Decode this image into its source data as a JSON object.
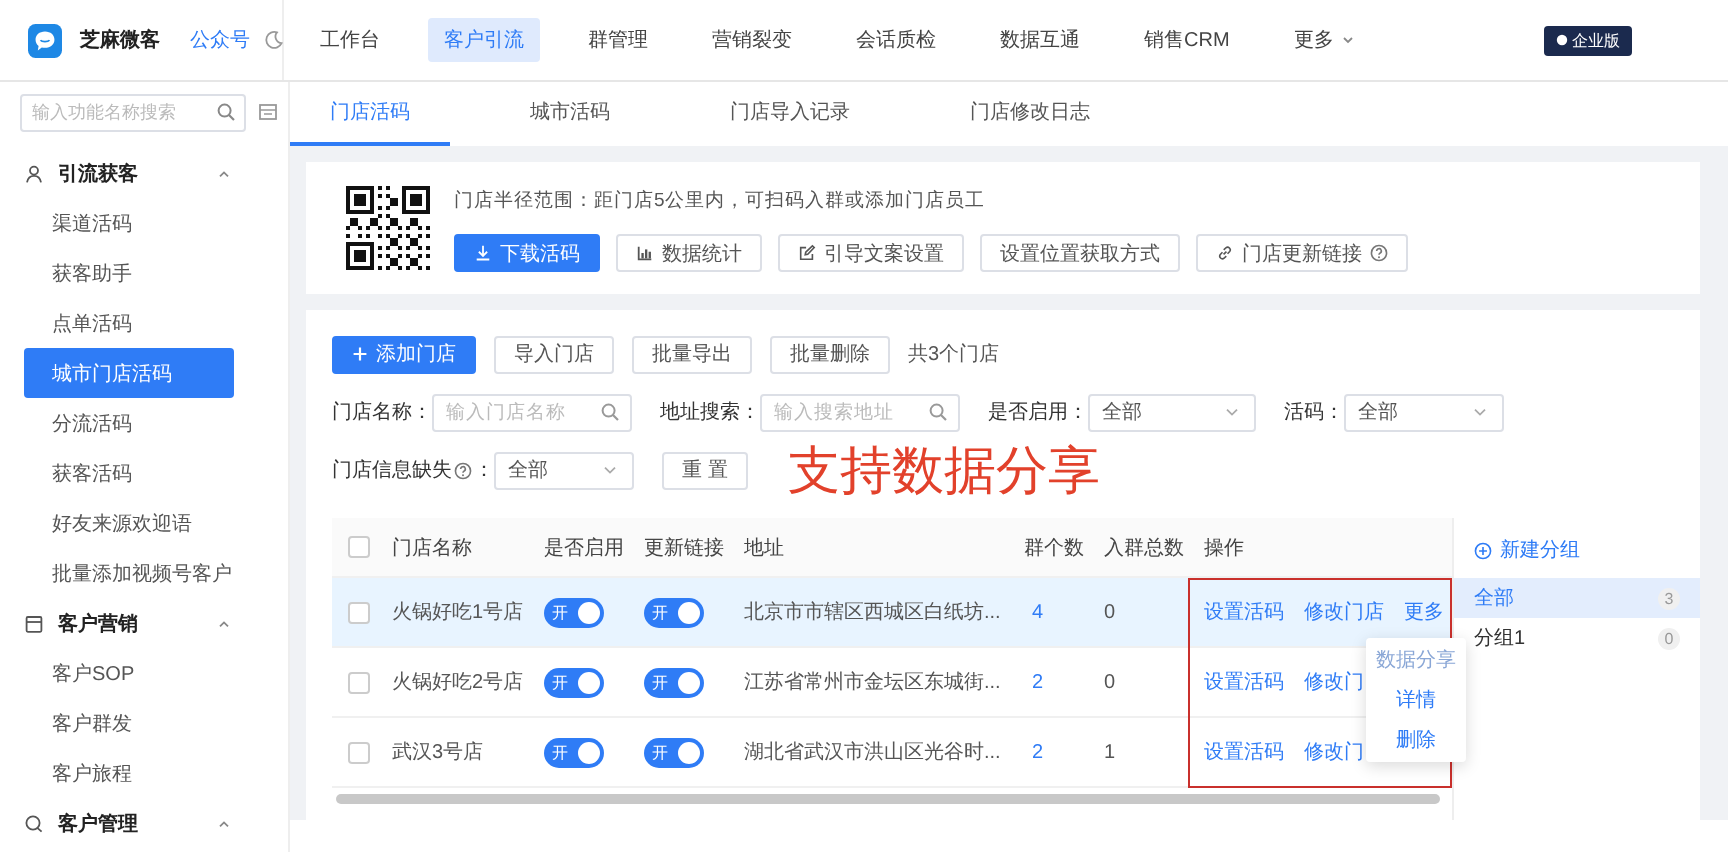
{
  "app": {
    "name": "芝麻微客",
    "account_link": "公众号"
  },
  "nav": [
    {
      "label": "工作台",
      "selected": false,
      "kind": "link"
    },
    {
      "label": "客户引流",
      "selected": true,
      "kind": "link"
    },
    {
      "label": "群管理",
      "selected": false,
      "kind": "link"
    },
    {
      "label": "营销裂变",
      "selected": false,
      "kind": "link"
    },
    {
      "label": "会话质检",
      "selected": false,
      "kind": "link"
    },
    {
      "label": "数据互通",
      "selected": false,
      "kind": "link"
    },
    {
      "label": "销售CRM",
      "selected": false,
      "kind": "link"
    },
    {
      "label": "更多",
      "selected": false,
      "kind": "dropdown"
    }
  ],
  "edition_badge": "企业版",
  "sidebar": {
    "search_placeholder": "输入功能名称搜索",
    "groups": [
      {
        "label": "引流获客",
        "expanded": true,
        "children": [
          {
            "label": "渠道活码",
            "selected": false
          },
          {
            "label": "获客助手",
            "selected": false
          },
          {
            "label": "点单活码",
            "selected": false
          },
          {
            "label": "城市门店活码",
            "selected": true
          },
          {
            "label": "分流活码",
            "selected": false
          },
          {
            "label": "获客活码",
            "selected": false
          },
          {
            "label": "好友来源欢迎语",
            "selected": false
          },
          {
            "label": "批量添加视频号客户",
            "selected": false
          }
        ]
      },
      {
        "label": "客户营销",
        "expanded": true,
        "children": [
          {
            "label": "客户SOP",
            "selected": false
          },
          {
            "label": "客户群发",
            "selected": false
          },
          {
            "label": "客户旅程",
            "selected": false
          }
        ]
      },
      {
        "label": "客户管理",
        "expanded": true
      }
    ]
  },
  "tabs": [
    {
      "label": "门店活码",
      "selected": true
    },
    {
      "label": "城市活码",
      "selected": false
    },
    {
      "label": "门店导入记录",
      "selected": false
    },
    {
      "label": "门店修改日志",
      "selected": false
    }
  ],
  "banner": {
    "description": "门店半径范围：距门店5公里内，可扫码入群或添加门店员工",
    "buttons": [
      {
        "label": "下载活码",
        "kind": "primary",
        "help": false
      },
      {
        "label": "数据统计",
        "kind": "default",
        "help": false
      },
      {
        "label": "引导文案设置",
        "kind": "default",
        "help": false
      },
      {
        "label": "设置位置获取方式",
        "kind": "default",
        "help": false
      },
      {
        "label": "门店更新链接",
        "kind": "default",
        "help": true
      }
    ]
  },
  "toolbar": {
    "buttons": [
      {
        "label": "添加门店",
        "kind": "primary"
      },
      {
        "label": "导入门店",
        "kind": "default"
      },
      {
        "label": "批量导出",
        "kind": "default"
      },
      {
        "label": "批量删除",
        "kind": "default"
      }
    ],
    "count": "共3个门店"
  },
  "filter_rows": [
    [
      {
        "label": "门店名称：",
        "kind": "search",
        "placeholder": "输入门店名称",
        "help": false
      },
      {
        "label": "地址搜索：",
        "kind": "search",
        "placeholder": "输入搜索地址",
        "help": false
      },
      {
        "label": "是否启用：",
        "kind": "select",
        "value": "全部",
        "help": false
      },
      {
        "label": "活码：",
        "kind": "select",
        "value": "全部",
        "help": false
      }
    ],
    [
      {
        "label": "门店信息缺失",
        "suffix": "：",
        "kind": "select",
        "value": "全部",
        "help": true
      }
    ]
  ],
  "reset_button": "重 置",
  "annotation": "支持数据分享",
  "table": {
    "select_all_checked": false,
    "columns": [
      "门店名称",
      "是否启用",
      "更新链接",
      "地址",
      "群个数",
      "入群总数",
      "操作"
    ],
    "rows": [
      {
        "checked": false,
        "highlighted": true,
        "name": "火锅好吃1号店",
        "enabled": true,
        "enabled_label": "开",
        "link_update": true,
        "link_update_label": "开",
        "address": "北京市市辖区西城区白纸坊...",
        "groups": "4",
        "members": "0",
        "actions": [
          "设置活码",
          "修改门店",
          "更多"
        ]
      },
      {
        "checked": false,
        "highlighted": false,
        "name": "火锅好吃2号店",
        "enabled": true,
        "enabled_label": "开",
        "link_update": true,
        "link_update_label": "开",
        "address": "江苏省常州市金坛区东城街...",
        "groups": "2",
        "members": "0",
        "actions": [
          "设置活码",
          "修改门"
        ]
      },
      {
        "checked": false,
        "highlighted": false,
        "name": "武汉3号店",
        "enabled": true,
        "enabled_label": "开",
        "link_update": true,
        "link_update_label": "开",
        "address": "湖北省武汉市洪山区光谷时...",
        "groups": "2",
        "members": "1",
        "actions": [
          "设置活码",
          "修改门"
        ]
      }
    ]
  },
  "more_menu": {
    "items": [
      "数据分享",
      "详情",
      "删除"
    ]
  },
  "group_panel": {
    "new_label": "新建分组",
    "items": [
      {
        "label": "全部",
        "count": "3",
        "selected": true
      },
      {
        "label": "分组1",
        "count": "0",
        "selected": false
      }
    ]
  }
}
